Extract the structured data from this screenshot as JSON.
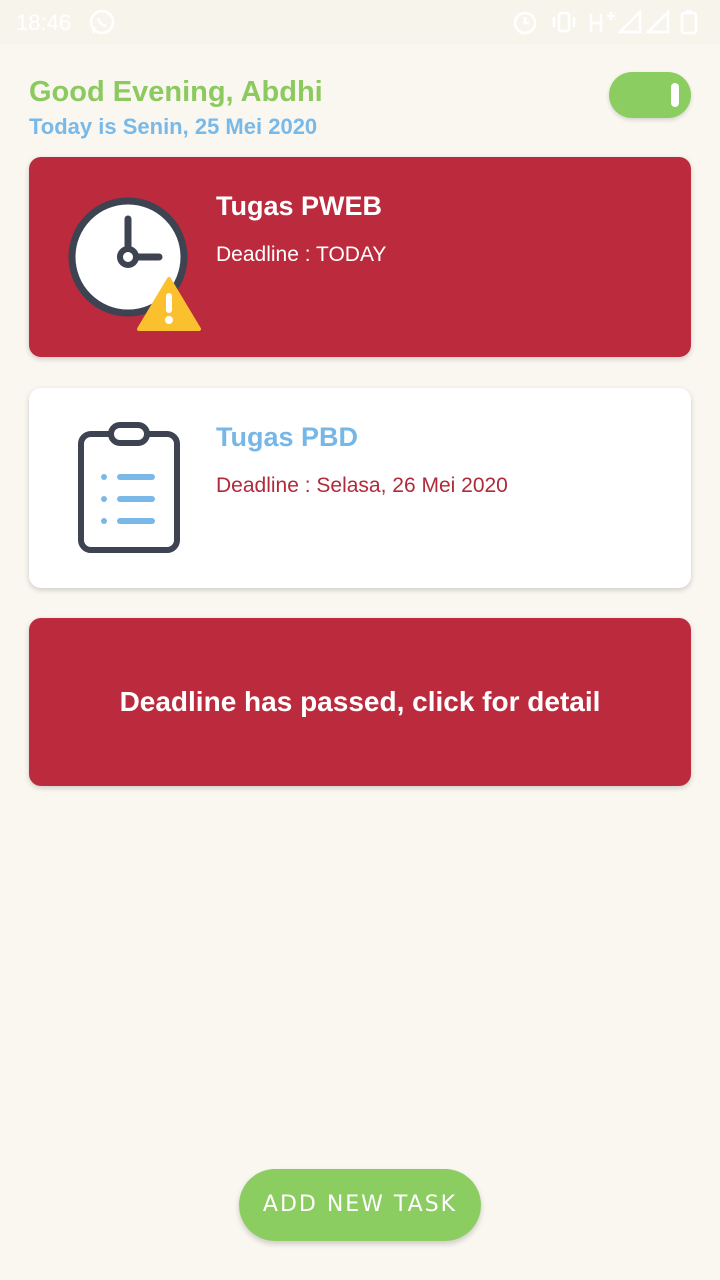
{
  "status_bar": {
    "time": "18:46",
    "icons": [
      "whatsapp-icon",
      "alarm-icon",
      "vibrate-icon",
      "network-h-plus-icon",
      "signal-icon",
      "signal-icon-2",
      "battery-icon"
    ]
  },
  "header": {
    "greeting": "Good Evening, Abdhi",
    "date_line": "Today is Senin, 25 Mei 2020",
    "toggle": {
      "state": "on"
    }
  },
  "tasks": [
    {
      "title": "Tugas PWEB",
      "deadline": "Deadline : TODAY",
      "icon": "clock-warning-icon",
      "style": "urgent"
    },
    {
      "title": "Tugas PBD",
      "deadline": "Deadline : Selasa, 26 Mei 2020",
      "icon": "clipboard-list-icon",
      "style": "normal"
    }
  ],
  "passed_banner": {
    "text": "Deadline has passed, click for detail"
  },
  "add_button": {
    "label": "ADD NEW TASK"
  },
  "colors": {
    "background": "#faf7f0",
    "green": "#8ccd62",
    "blue": "#79b9e8",
    "red": "#bc2a3d",
    "white": "#ffffff"
  }
}
